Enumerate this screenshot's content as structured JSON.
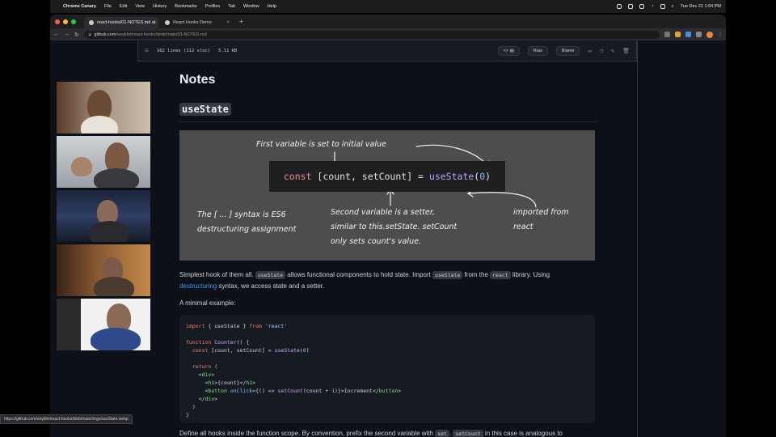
{
  "menubar": {
    "app_name": "Chrome Canary",
    "menus": [
      "File",
      "Edit",
      "View",
      "History",
      "Bookmarks",
      "Profiles",
      "Tab",
      "Window",
      "Help"
    ],
    "clock": "Tue Dec 21  1:04 PM"
  },
  "tabs": [
    {
      "label": "react-hooks/01-NOTES.md at",
      "active": true
    },
    {
      "label": "React Hooks Demo",
      "active": false
    }
  ],
  "toolbar": {
    "url_host": "github.com",
    "url_path": "/eeyklm/react-hooks/blob/main/01-NOTES.md"
  },
  "file_header": {
    "line_info": "162 lines (112 sloc)",
    "size": "5.11 KB",
    "raw_label": "Raw",
    "blame_label": "Blame"
  },
  "article": {
    "title": "Notes",
    "heading": "useState",
    "diagram": {
      "code_const": "const",
      "code_vars": " [count, setCount] = ",
      "code_fn": "useState",
      "code_open": "(",
      "code_arg": "0",
      "code_close": ")",
      "note_first": "First variable is set to initial value",
      "note_syntax_1": "The [ ... ] syntax is ES6",
      "note_syntax_2": "destructuring assignment",
      "note_second_1": "Second variable is a setter,",
      "note_second_2": "similar to this.setState. setCount",
      "note_second_3": "only sets count's value.",
      "note_imported_1": "imported from",
      "note_imported_2": "react"
    },
    "para1_a": "Simplest hook of them all. ",
    "para1_code1": "useState",
    "para1_b": " allows functional components to hold state. Import ",
    "para1_code2": "useState",
    "para1_c": " from the ",
    "para1_code3": "react",
    "para1_d": " library. Using",
    "para1_link": "destructuring",
    "para1_e": " syntax, we access state and a setter.",
    "para2": "A minimal example:",
    "code_lines": [
      "import { useState } from 'react'",
      "",
      "function Counter() {",
      "  const [count, setCount] = useState(0)",
      "",
      "  return (",
      "    <div>",
      "      <h1>{count}</h1>",
      "      <button onClick={() => setCount(count + 1)}>Increment</button>",
      "    </div>",
      "  )",
      "}"
    ],
    "para3_a": "Define all hooks inside the function scope. By convention, prefix the second variable with ",
    "para3_code1": "set",
    "para3_b": ". ",
    "para3_code2": "setCount",
    "para3_c": " in this case is analogous to"
  },
  "status_url": "https://github.com/eeyklm/react-hooks/blob/main/imgs/useState.webp",
  "colors": {
    "page_bg": "#0d1117",
    "diagram_bg": "#4d4d4d",
    "link": "#4493f8"
  }
}
